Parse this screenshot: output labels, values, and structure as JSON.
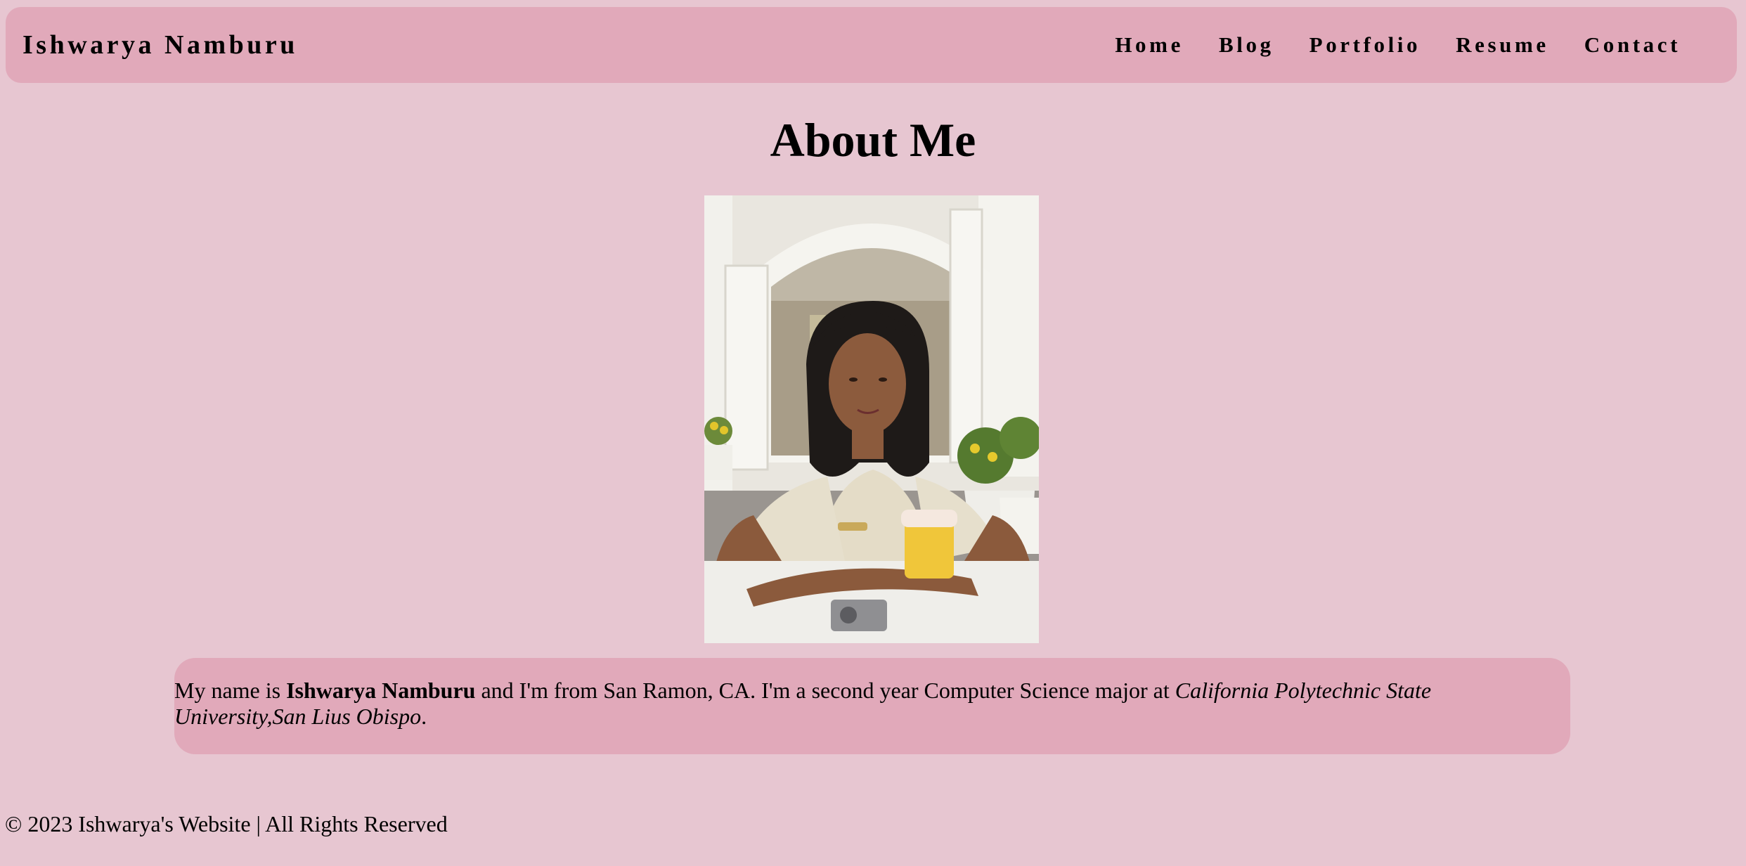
{
  "header": {
    "brand": "Ishwarya Namburu",
    "nav": [
      "Home",
      "Blog",
      "Portfolio",
      "Resume",
      "Contact"
    ]
  },
  "main": {
    "title": "About Me",
    "photo_alt": "Ishwarya Namburu",
    "bio": {
      "part1": "My name is ",
      "name": "Ishwarya Namburu",
      "part2": " and I'm from San Ramon, CA. I'm a second year Computer Science major at ",
      "university": "California Polytechnic State University,San Lius Obispo",
      "part3": "."
    }
  },
  "footer": {
    "text": "© 2023 Ishwarya's Website | All Rights Reserved"
  },
  "colors": {
    "page_background": "#e7c6d1",
    "panel_background": "#e1a9ba"
  }
}
